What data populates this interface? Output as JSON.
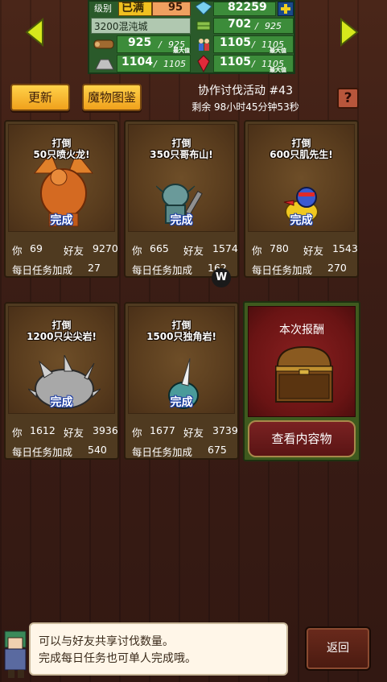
{
  "status_panel": {
    "level_label": "级别",
    "level_value": "已满",
    "level_num": "95",
    "gems": "82259",
    "town_name": "3200混沌城",
    "food_value": "702",
    "food_max": "925",
    "wood_value": "925",
    "wood_max": "925",
    "workers_value": "1105",
    "workers_max": "1105",
    "stone_value": "1104",
    "stone_max": "1105",
    "crystal_value": "1105",
    "crystal_max": "1105",
    "max_label": "最大值"
  },
  "header": {
    "update_label": "更新",
    "bestiary_label": "魔物图鉴",
    "event_title": "协作讨伐活动 #43",
    "timer": "剩余 98小时45分钟53秒",
    "help_label": "?"
  },
  "cards": [
    {
      "line1": "打倒",
      "line2": "50只喷火龙!",
      "done": "完成",
      "you_label": "你",
      "you": "69",
      "friend_label": "好友",
      "friend": "9270",
      "bonus_label": "每日任务加成",
      "bonus": "27",
      "icon": "dragon-icon",
      "color": "#d46a22"
    },
    {
      "line1": "打倒",
      "line2": "350只哥布山!",
      "done": "完成",
      "you_label": "你",
      "you": "665",
      "friend_label": "好友",
      "friend": "1574",
      "bonus_label": "每日任务加成",
      "bonus": "162",
      "icon": "goblin-icon",
      "color": "#5a8a8a"
    },
    {
      "line1": "打倒",
      "line2": "600只肌先生!",
      "done": "完成",
      "you_label": "你",
      "you": "780",
      "friend_label": "好友",
      "friend": "1543",
      "bonus_label": "每日任务加成",
      "bonus": "270",
      "icon": "bird-icon",
      "color": "#e8c020"
    },
    {
      "line1": "打倒",
      "line2": "1200只尖尖岩!",
      "done": "完成",
      "you_label": "你",
      "you": "1612",
      "friend_label": "好友",
      "friend": "3936",
      "bonus_label": "每日任务加成",
      "bonus": "540",
      "icon": "spiky-rock-icon",
      "color": "#9a9a9a"
    },
    {
      "line1": "打倒",
      "line2": "1500只独角岩!",
      "done": "完成",
      "you_label": "你",
      "you": "1677",
      "friend_label": "好友",
      "friend": "3739",
      "bonus_label": "每日任务加成",
      "bonus": "675",
      "icon": "horn-rock-icon",
      "color": "#5aaaaa"
    }
  ],
  "reward": {
    "title": "本次报酬",
    "view_label": "查看内容物"
  },
  "mini_badge": "W",
  "dialog": {
    "line1": "可以与好友共享讨伐数量。",
    "line2": "完成每日任务也可单人完成哦。"
  },
  "back_label": "返回"
}
